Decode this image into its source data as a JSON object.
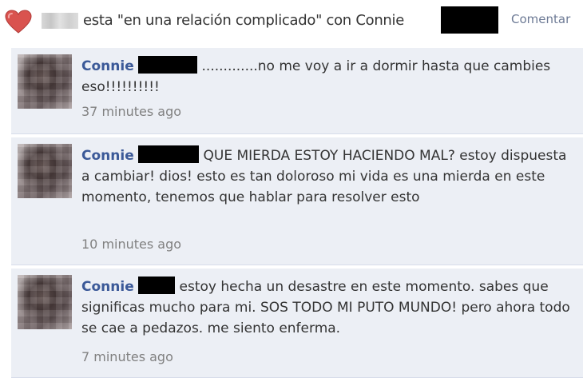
{
  "status": {
    "text": "esta \"en una relación complicado\" con Connie",
    "comment_link": "Comentar"
  },
  "colors": {
    "link_blue": "#3b5998",
    "comment_bg": "#eceff5",
    "heart": "#d9534f",
    "timestamp": "#808080"
  },
  "comments": [
    {
      "author": "Connie",
      "text": ".............no me voy a ir a dormir hasta que cambies eso!!!!!!!!!!",
      "time": "37 minutes ago"
    },
    {
      "author": "Connie",
      "text": "QUE MIERDA ESTOY HACIENDO MAL? estoy dispuesta a cambiar! dios! esto es tan doloroso mi vida es una mierda en este momento, tenemos que hablar para resolver esto",
      "time": "10 minutes ago"
    },
    {
      "author": "Connie",
      "text": "estoy hecha un desastre en este momento. sabes que significas mucho para mi. SOS TODO MI PUTO MUNDO! pero ahora todo se cae a pedazos. me siento enferma.",
      "time": "7 minutes ago"
    }
  ]
}
